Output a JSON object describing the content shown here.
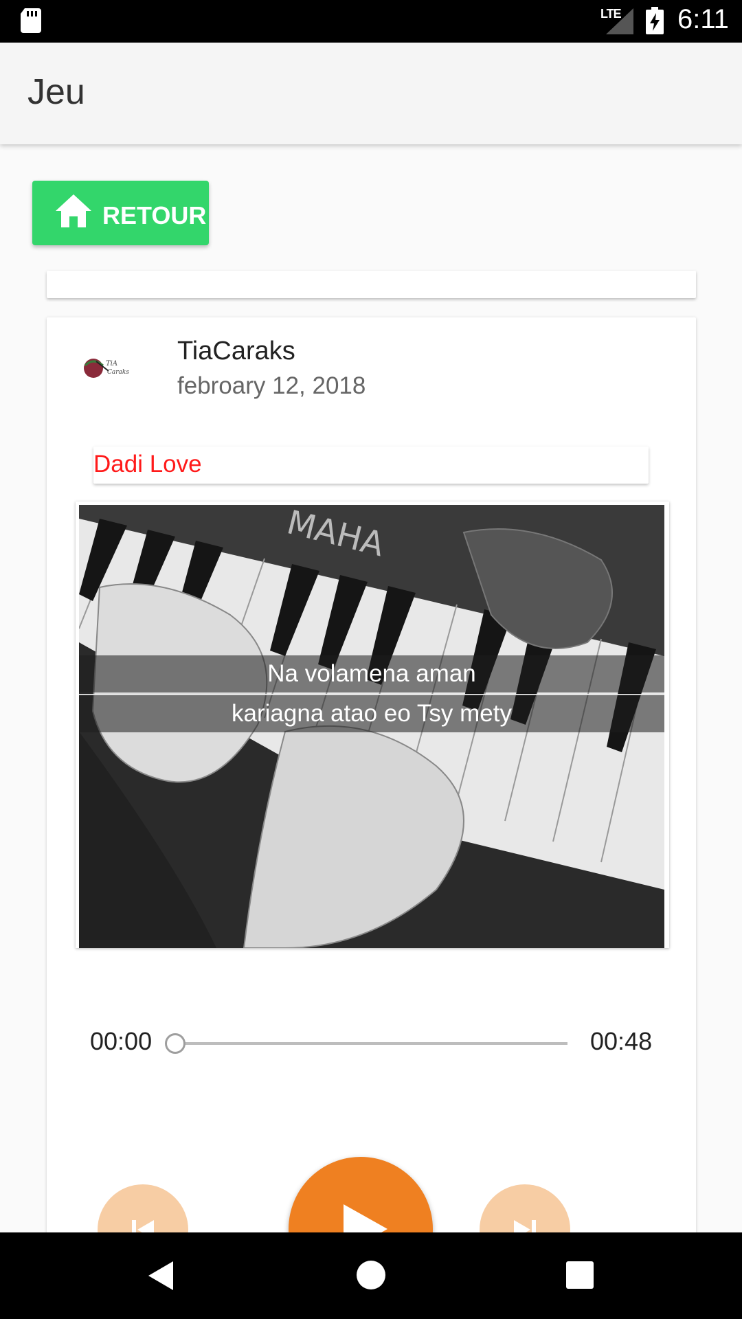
{
  "status_bar": {
    "network": "LTE",
    "time": "6:11"
  },
  "app_bar": {
    "title": "Jeu"
  },
  "back_button": {
    "label": "RETOUR"
  },
  "post": {
    "author": "TiaCaraks",
    "date": "febroary 12, 2018",
    "avatar_text": "TiA Caraks",
    "song_title": "Dadi Love",
    "lyrics": [
      "Na volamena aman",
      "kariagna atao eo Tsy mety"
    ],
    "artwork_text": "MAHA"
  },
  "player": {
    "elapsed": "00:00",
    "duration": "00:48",
    "progress": 0
  },
  "colors": {
    "back_button": "#33d66b",
    "play_button": "#ef8021",
    "secondary_buttons": "#f7cda4",
    "song_title": "#ff1a1a"
  }
}
